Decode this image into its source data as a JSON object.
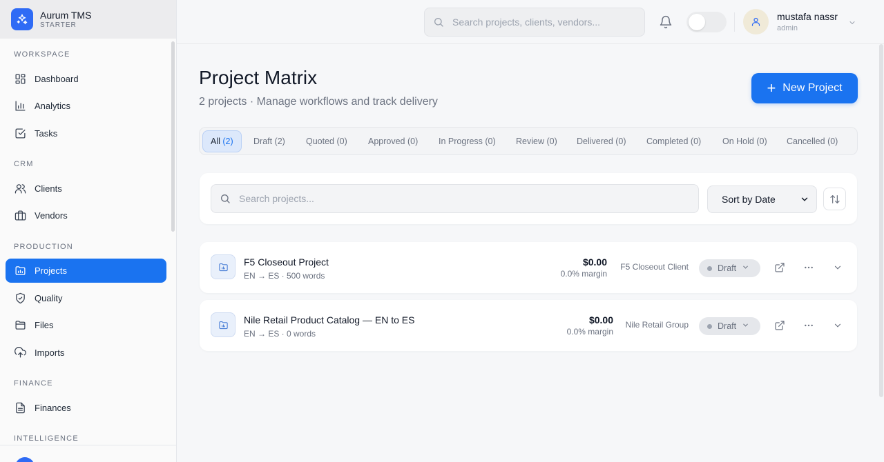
{
  "brand": {
    "name": "Aurum TMS",
    "plan": "STARTER"
  },
  "sidebar": {
    "sections": [
      {
        "label": "WORKSPACE"
      },
      {
        "label": "CRM"
      },
      {
        "label": "PRODUCTION"
      },
      {
        "label": "FINANCE"
      },
      {
        "label": "INTELLIGENCE"
      }
    ],
    "items": [
      {
        "label": "Dashboard",
        "icon": "dashboard-icon"
      },
      {
        "label": "Analytics",
        "icon": "bar-chart-icon"
      },
      {
        "label": "Tasks",
        "icon": "checkbox-icon"
      },
      {
        "label": "Clients",
        "icon": "users-icon"
      },
      {
        "label": "Vendors",
        "icon": "briefcase-icon"
      },
      {
        "label": "Projects",
        "icon": "folder-chart-icon",
        "active": true
      },
      {
        "label": "Quality",
        "icon": "shield-check-icon"
      },
      {
        "label": "Files",
        "icon": "folder-icon"
      },
      {
        "label": "Imports",
        "icon": "upload-cloud-icon"
      },
      {
        "label": "Finances",
        "icon": "document-icon"
      }
    ]
  },
  "topbar": {
    "search_placeholder": "Search projects, clients, vendors...",
    "user": {
      "name": "mustafa nassr",
      "role": "admin"
    }
  },
  "main": {
    "title": "Project Matrix",
    "subtitle": "2 projects · Manage workflows and track delivery",
    "new_button": "New Project",
    "tabs": [
      {
        "label": "All",
        "count": "(2)",
        "active": true
      },
      {
        "label": "Draft (2)"
      },
      {
        "label": "Quoted (0)"
      },
      {
        "label": "Approved (0)"
      },
      {
        "label": "In Progress (0)"
      },
      {
        "label": "Review (0)"
      },
      {
        "label": "Delivered (0)"
      },
      {
        "label": "Completed (0)"
      },
      {
        "label": "On Hold (0)"
      },
      {
        "label": "Cancelled (0)"
      }
    ],
    "filter": {
      "search_placeholder": "Search projects...",
      "sort_value": "Sort by Date"
    },
    "projects": [
      {
        "name": "F5 Closeout Project",
        "meta": "EN → ES · 500 words",
        "amount": "$0.00",
        "margin": "0.0% margin",
        "client": "F5 Closeout Client",
        "status": "Draft"
      },
      {
        "name": "Nile Retail Product Catalog — EN to ES",
        "meta": "EN → ES · 0 words",
        "amount": "$0.00",
        "margin": "0.0% margin",
        "client": "Nile Retail Group",
        "status": "Draft"
      }
    ]
  },
  "colors": {
    "accent": "#1a73f0",
    "sidebar_bg": "#fafafa",
    "page_bg": "#f6f7f9"
  }
}
